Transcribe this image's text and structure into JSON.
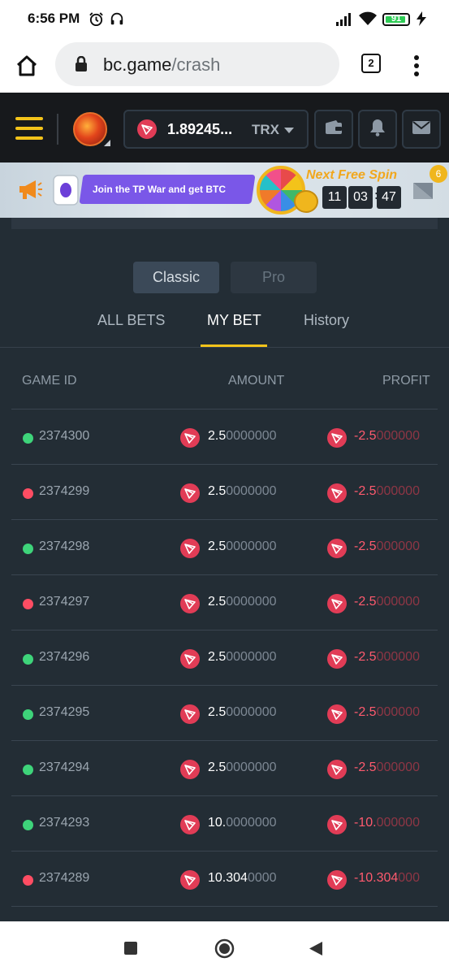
{
  "status_bar": {
    "time": "6:56 PM",
    "battery": "91",
    "battery_level": 0.91
  },
  "browser": {
    "url_host": "bc.game",
    "url_path": "/crash",
    "tab_count": "2"
  },
  "header": {
    "balance": "1.89245...",
    "currency": "TRX"
  },
  "banner": {
    "promo_text": "Join the TP War and get BTC",
    "spin_title": "Next Free Spin",
    "timer": {
      "hours": "11",
      "minutes": "03",
      "seconds": "47"
    },
    "notification_count": "6"
  },
  "mode_toggle": {
    "classic": "Classic",
    "pro": "Pro"
  },
  "tabs": {
    "all_bets": "ALL BETS",
    "my_bet": "MY BET",
    "history": "History"
  },
  "table": {
    "headers": {
      "game_id": "GAME ID",
      "amount": "AMOUNT",
      "profit": "PROFIT"
    },
    "rows": [
      {
        "status": "win",
        "game_id": "2374300",
        "amount_main": "2.5",
        "amount_tail": "0000000",
        "profit_main": "-2.5",
        "profit_tail": "000000"
      },
      {
        "status": "loss",
        "game_id": "2374299",
        "amount_main": "2.5",
        "amount_tail": "0000000",
        "profit_main": "-2.5",
        "profit_tail": "000000"
      },
      {
        "status": "win",
        "game_id": "2374298",
        "amount_main": "2.5",
        "amount_tail": "0000000",
        "profit_main": "-2.5",
        "profit_tail": "000000"
      },
      {
        "status": "loss",
        "game_id": "2374297",
        "amount_main": "2.5",
        "amount_tail": "0000000",
        "profit_main": "-2.5",
        "profit_tail": "000000"
      },
      {
        "status": "win",
        "game_id": "2374296",
        "amount_main": "2.5",
        "amount_tail": "0000000",
        "profit_main": "-2.5",
        "profit_tail": "000000"
      },
      {
        "status": "win",
        "game_id": "2374295",
        "amount_main": "2.5",
        "amount_tail": "0000000",
        "profit_main": "-2.5",
        "profit_tail": "000000"
      },
      {
        "status": "win",
        "game_id": "2374294",
        "amount_main": "2.5",
        "amount_tail": "0000000",
        "profit_main": "-2.5",
        "profit_tail": "000000"
      },
      {
        "status": "win",
        "game_id": "2374293",
        "amount_main": "10.",
        "amount_tail": "0000000",
        "profit_main": "-10.",
        "profit_tail": "000000"
      },
      {
        "status": "loss",
        "game_id": "2374289",
        "amount_main": "10.304",
        "amount_tail": "0000",
        "profit_main": "-10.304",
        "profit_tail": "000"
      }
    ]
  },
  "colors": {
    "accent": "#f3c31a",
    "win": "#3ed47a",
    "loss": "#ff4d63",
    "trx": "#e13c56",
    "background": "#232d35"
  },
  "icons": {
    "home": "home-icon",
    "lock": "lock-icon",
    "menu": "more-vert-icon",
    "alarm": "alarm-icon",
    "headset": "headset-icon",
    "signal": "signal-icon",
    "wifi": "wifi-icon",
    "charging": "charging-icon",
    "wallet": "wallet-icon",
    "bell": "bell-icon",
    "mail": "mail-icon",
    "megaphone": "megaphone-icon",
    "trx": "trx-icon",
    "stop": "square-icon",
    "home_nav": "circle-icon",
    "back": "triangle-icon"
  }
}
